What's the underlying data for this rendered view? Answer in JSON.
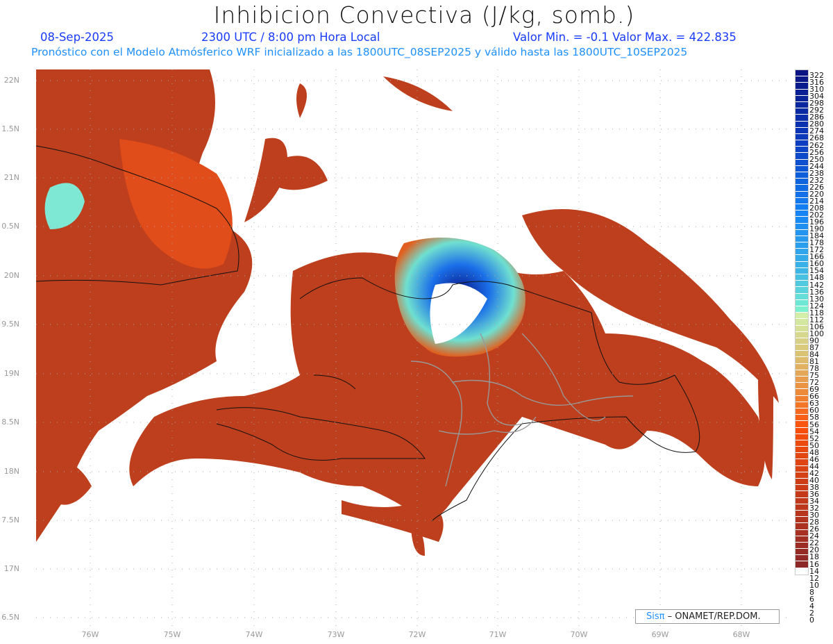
{
  "header": {
    "title": "Inhibicion Convectiva (J/kg, somb.)",
    "date": "08-Sep-2025",
    "time": "2300 UTC / 8:00 pm Hora Local",
    "minmax": "Valor Min. = -0.1  Valor Max. = 422.835",
    "forecast": "Pronóstico con el Modelo Atmósferico WRF inicializado a las 1800UTC_08SEP2025 y válido hasta las  1800UTC_10SEP2025"
  },
  "axes": {
    "lat_labels": [
      "22N",
      "1.5N",
      "21N",
      "0.5N",
      "20N",
      "9.5N",
      "19N",
      "8.5N",
      "18N",
      "7.5N",
      "17N",
      "6.5N"
    ],
    "lon_labels": [
      "76W",
      "75W",
      "74W",
      "73W",
      "72W",
      "71W",
      "70W",
      "69W",
      "68W"
    ]
  },
  "colorbar": {
    "labels": [
      "322",
      "316",
      "310",
      "304",
      "298",
      "292",
      "286",
      "280",
      "274",
      "268",
      "262",
      "256",
      "250",
      "244",
      "238",
      "232",
      "226",
      "220",
      "214",
      "208",
      "202",
      "196",
      "190",
      "184",
      "178",
      "172",
      "166",
      "160",
      "154",
      "148",
      "142",
      "136",
      "130",
      "124",
      "118",
      "112",
      "106",
      "100",
      "90",
      "87",
      "84",
      "81",
      "78",
      "75",
      "72",
      "69",
      "66",
      "63",
      "60",
      "58",
      "56",
      "54",
      "52",
      "50",
      "48",
      "46",
      "44",
      "42",
      "40",
      "38",
      "36",
      "34",
      "32",
      "30",
      "28",
      "26",
      "24",
      "22",
      "20",
      "18",
      "16",
      "14",
      "12",
      "10",
      "8",
      "6",
      "4",
      "2",
      "0"
    ]
  },
  "credit": {
    "brand": "Sisπ",
    "text": " – ONAMET/REP.DOM."
  },
  "colors": {
    "land_field": "#c0401c",
    "high_blue": "#0a1a8a",
    "accent": "#1e90ff"
  }
}
